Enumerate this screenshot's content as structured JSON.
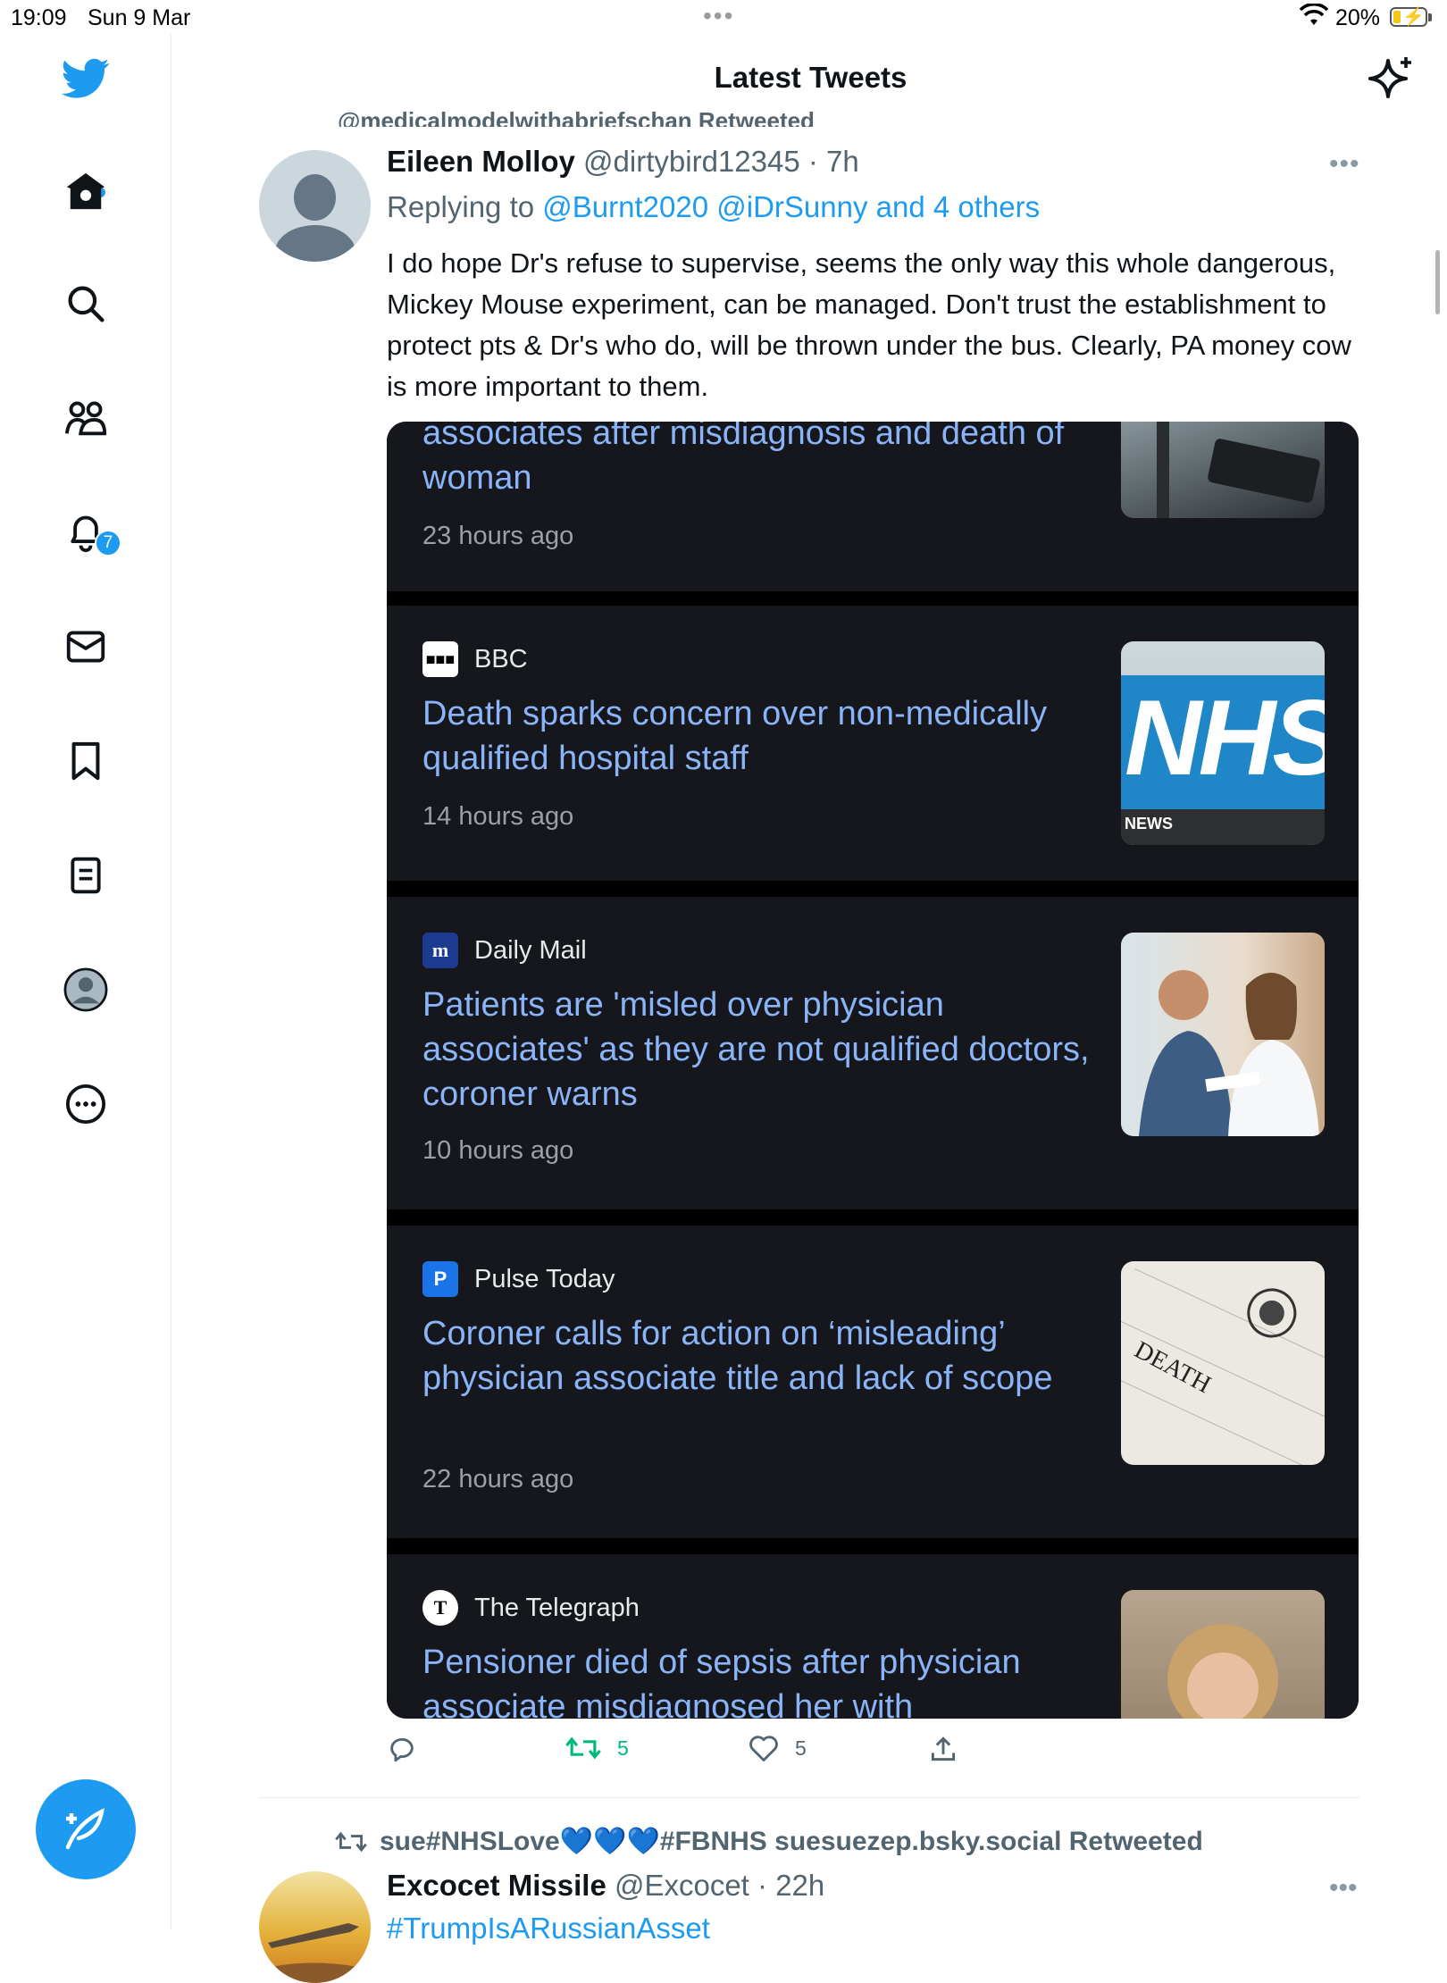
{
  "status_bar": {
    "time": "19:09",
    "date": "Sun 9 Mar",
    "battery": "20%"
  },
  "header": {
    "title": "Latest Tweets"
  },
  "sidebar": {
    "notification_count": "7"
  },
  "tweet": {
    "retweeted_by": "@medicalmodelwithabriefschan Retweeted",
    "name": "Eileen Molloy",
    "handle": "@dirtybird12345",
    "time": "· 7h",
    "replying_prefix": "Replying to",
    "replying_to": "@Burnt2020 @iDrSunny and 4 others",
    "text": "I do hope Dr's refuse to supervise, seems the only way this whole dangerous, Mickey Mouse experiment, can be managed. Don't trust the establishment to protect pts & Dr's who do,  will be thrown under the bus. Clearly,  PA money cow is more important to them.",
    "cards": [
      {
        "source": "",
        "headline": "associates after misdiagnosis and death of woman",
        "ago": "23 hours ago"
      },
      {
        "source": "BBC",
        "headline": "Death sparks concern over non-medically qualified hospital staff",
        "ago": "14 hours ago",
        "thumb_text": "NHS",
        "thumb_sub": "NEWS"
      },
      {
        "source": "Daily Mail",
        "headline": "Patients are 'misled over physician associates' as they are not qualified doctors, coroner warns",
        "ago": "10 hours ago"
      },
      {
        "source": "Pulse Today",
        "headline": "Coroner calls for action on ‘misleading’ physician associate title and lack of scope",
        "ago": "22 hours ago",
        "thumb_text": "DEATH"
      },
      {
        "source": "The Telegraph",
        "headline": "Pensioner died of sepsis after physician associate misdiagnosed her with",
        "ago": ""
      }
    ],
    "actions": {
      "retweets": "5",
      "likes": "5"
    }
  },
  "next_tweet": {
    "retweeted_by": "sue#NHSLove💙💙💙#FBNHS suesuezep.bsky.social Retweeted",
    "name": "Excocet Missile",
    "handle": "@Excocet",
    "time": "· 22h",
    "text": "#TrumpIsARussianAsset"
  },
  "colors": {
    "accent": "#1d9bf0",
    "retweet_green": "#00ba7c",
    "card_bg": "#16171c",
    "headline": "#8ab4f8"
  }
}
